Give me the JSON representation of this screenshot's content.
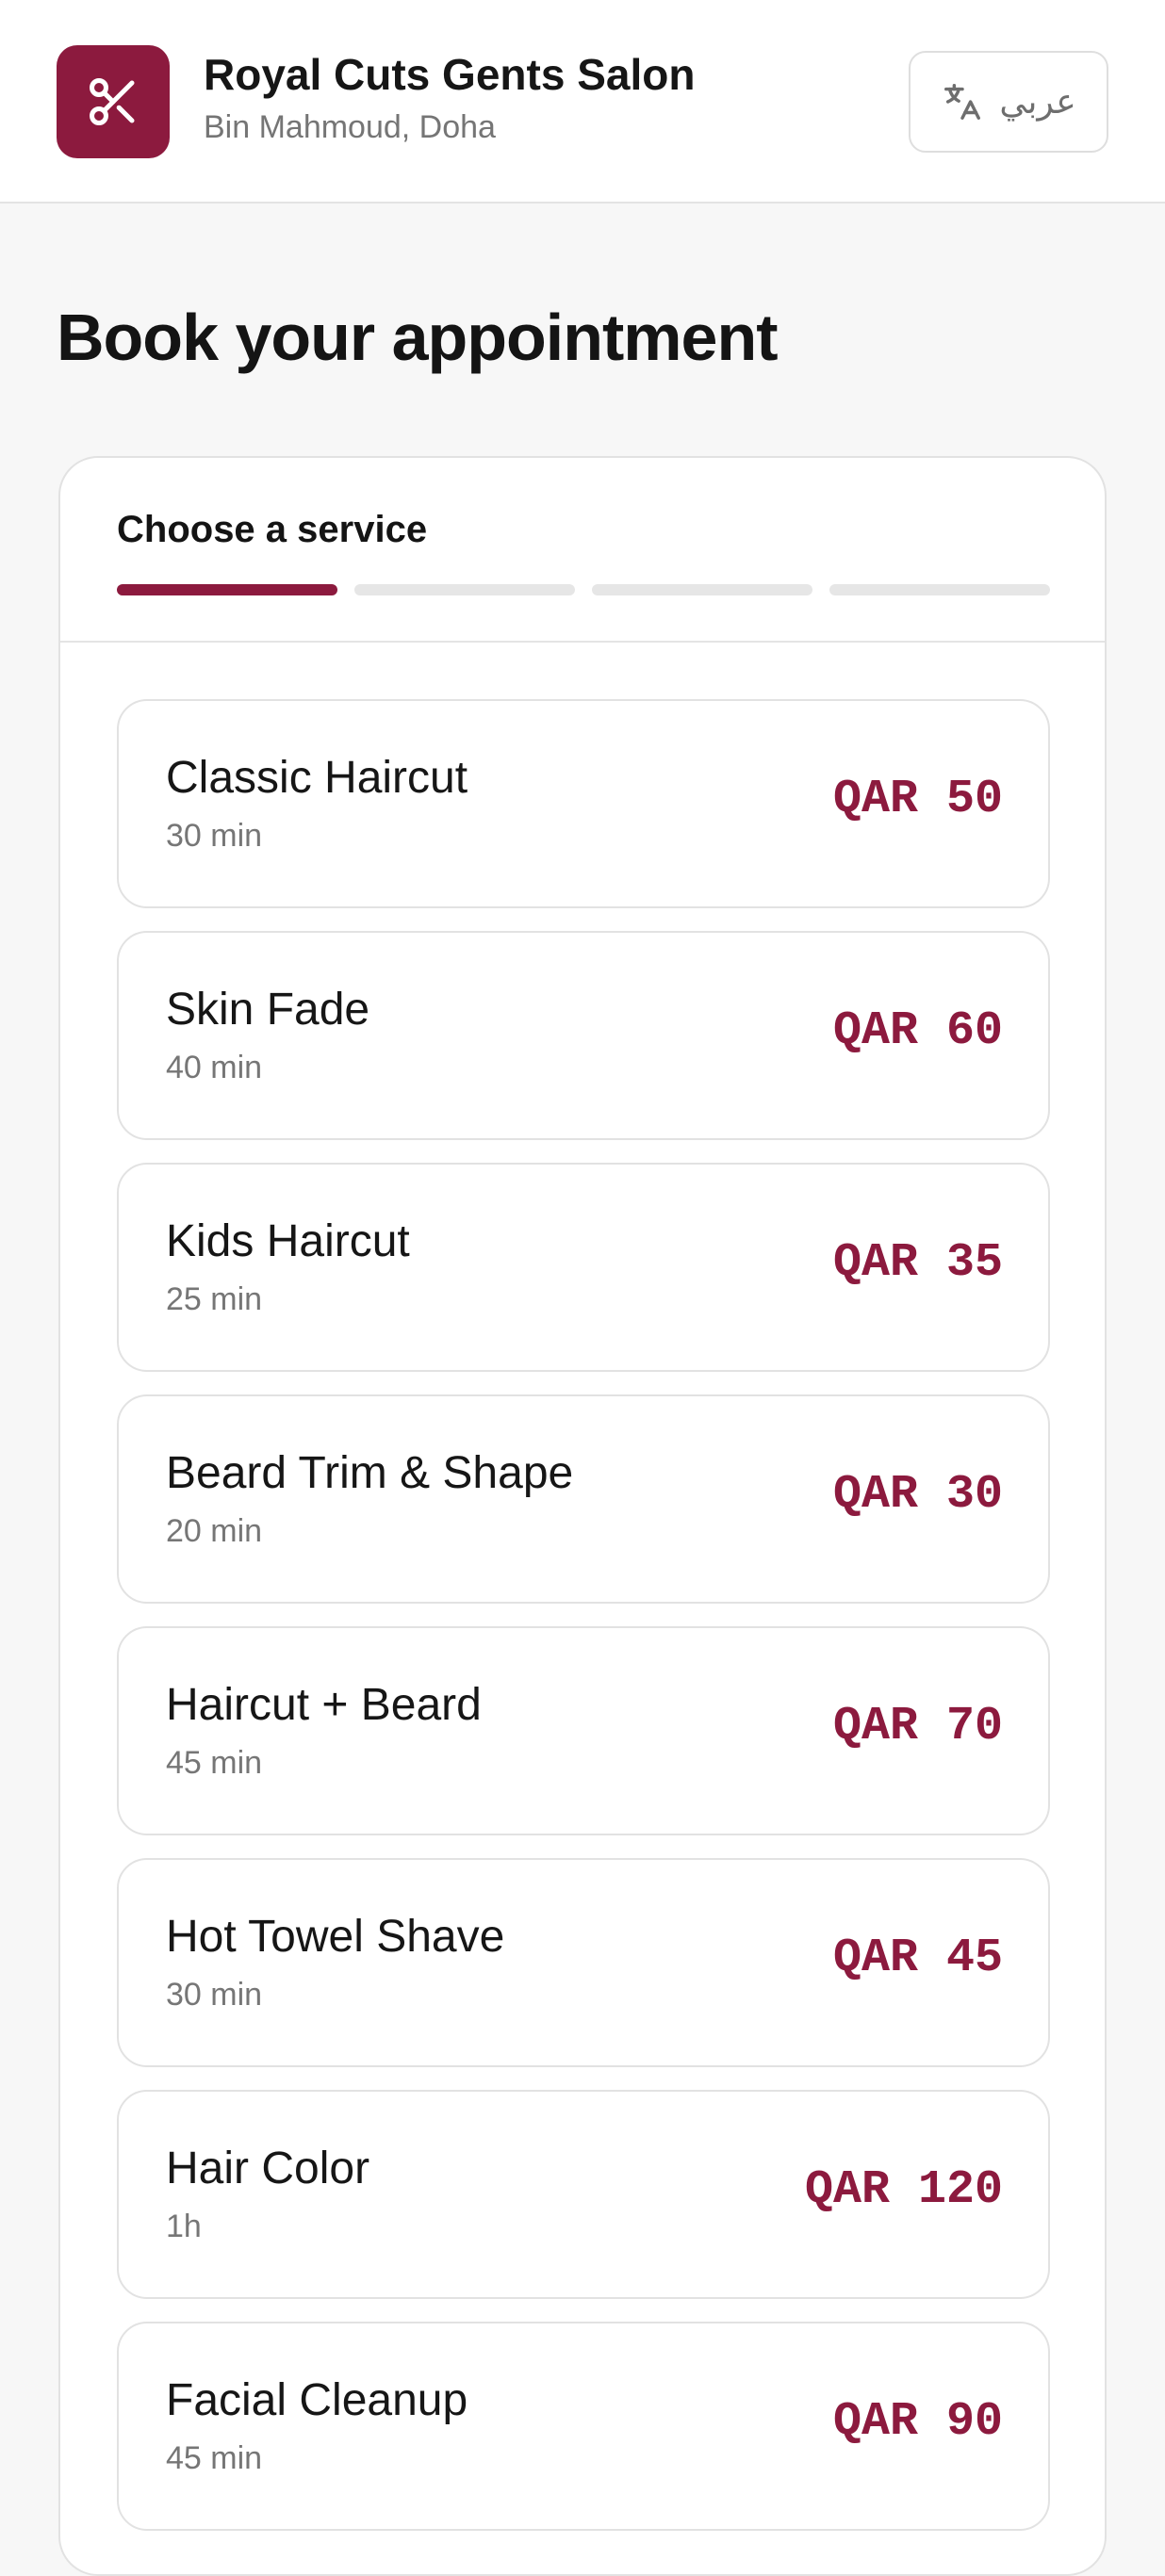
{
  "header": {
    "salon_name": "Royal Cuts Gents Salon",
    "location": "Bin Mahmoud, Doha",
    "logo_icon": "scissors-icon",
    "language_button": {
      "icon": "translate-icon",
      "label": "عربي"
    }
  },
  "page": {
    "title": "Book your appointment"
  },
  "booking": {
    "step_title": "Choose a service",
    "steps_total": 4,
    "current_step": 1
  },
  "services": [
    {
      "name": "Classic Haircut",
      "duration": "30 min",
      "price": "QAR 50"
    },
    {
      "name": "Skin Fade",
      "duration": "40 min",
      "price": "QAR 60"
    },
    {
      "name": "Kids Haircut",
      "duration": "25 min",
      "price": "QAR 35"
    },
    {
      "name": "Beard Trim & Shape",
      "duration": "20 min",
      "price": "QAR 30"
    },
    {
      "name": "Haircut + Beard",
      "duration": "45 min",
      "price": "QAR 70"
    },
    {
      "name": "Hot Towel Shave",
      "duration": "30 min",
      "price": "QAR 45"
    },
    {
      "name": "Hair Color",
      "duration": "1h",
      "price": "QAR 120"
    },
    {
      "name": "Facial Cleanup",
      "duration": "45 min",
      "price": "QAR 90"
    }
  ],
  "colors": {
    "brand": "#8c1a3e",
    "page_background": "#f7f7f7",
    "border": "#e2e2e2",
    "muted_text": "#767676"
  }
}
